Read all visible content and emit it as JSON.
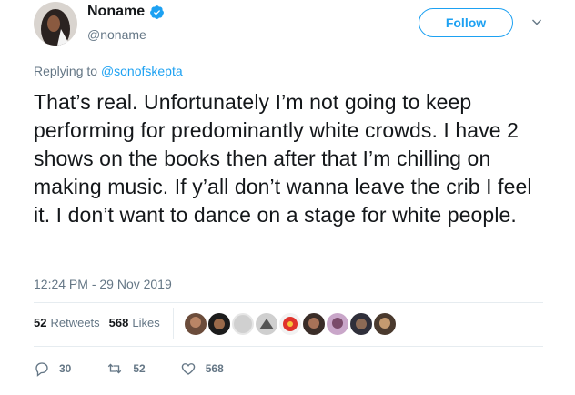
{
  "author": {
    "name": "Noname",
    "handle": "@noname",
    "verified_icon": "verified-badge-icon",
    "avatar_icon": "user-avatar"
  },
  "header": {
    "follow_label": "Follow",
    "menu_icon": "chevron-down-icon"
  },
  "reply": {
    "prefix": "Replying to",
    "mention": "@sonofskepta"
  },
  "tweet": {
    "text": "That’s real. Unfortunately I’m not going to keep performing for predominantly white crowds. I have 2 shows on the books then after that I’m chilling on making music. If y’all don’t wanna leave the crib I feel it. I don’t want to dance on a stage for white people.",
    "timestamp": "12:24 PM - 29 Nov 2019"
  },
  "stats": {
    "retweets_count": "52",
    "retweets_label": "Retweets",
    "likes_count": "568",
    "likes_label": "Likes"
  },
  "actions": {
    "reply_count": "30",
    "retweet_count": "52",
    "like_count": "568"
  },
  "colors": {
    "accent": "#1da1f2",
    "muted": "#657786",
    "text": "#14171a"
  }
}
